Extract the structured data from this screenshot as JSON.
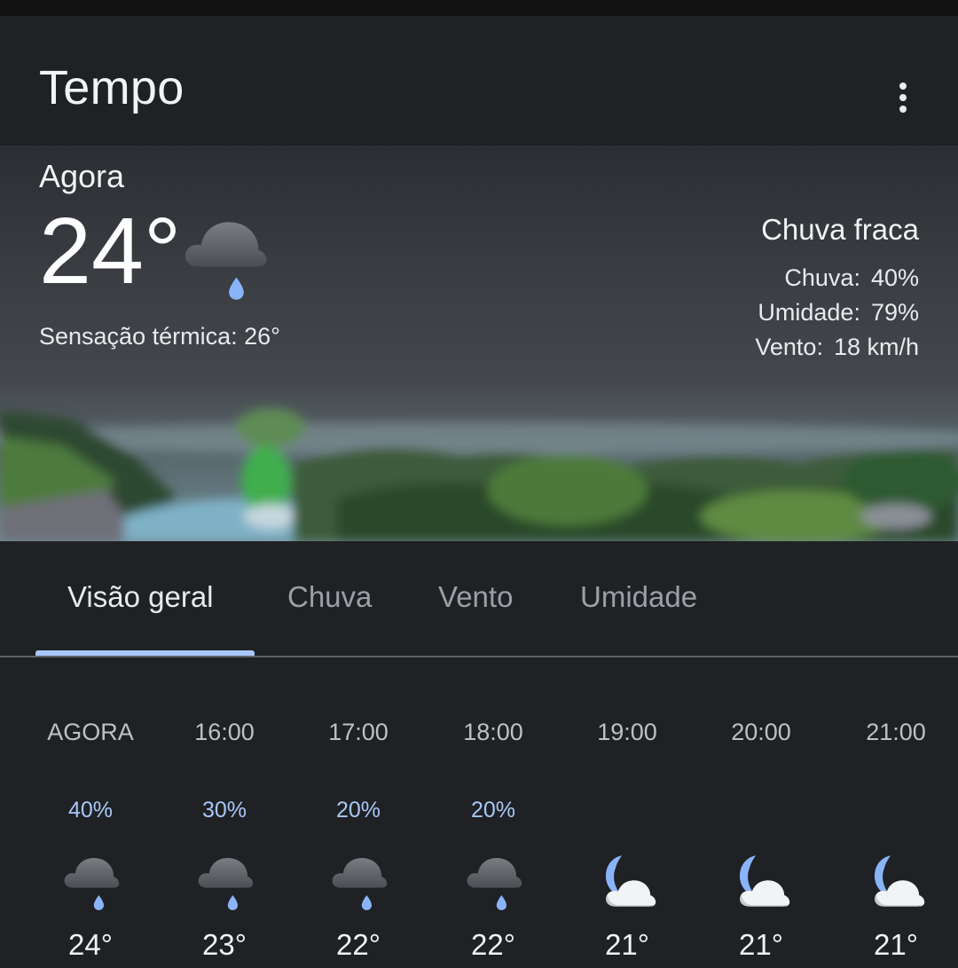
{
  "app": {
    "title": "Tempo"
  },
  "current": {
    "label": "Agora",
    "temperature": "24°",
    "feels_like": "Sensação térmica: 26°",
    "condition": "Chuva fraca",
    "condition_icon": "cloud-rain-icon",
    "details": [
      {
        "label": "Chuva:",
        "value": "40%"
      },
      {
        "label": "Umidade:",
        "value": "79%"
      },
      {
        "label": "Vento:",
        "value": "18 km/h"
      }
    ]
  },
  "tabs": [
    {
      "label": "Visão geral",
      "active": true
    },
    {
      "label": "Chuva",
      "active": false
    },
    {
      "label": "Vento",
      "active": false
    },
    {
      "label": "Umidade",
      "active": false
    }
  ],
  "hourly": [
    {
      "time": "AGORA",
      "precip": "40%",
      "icon": "cloud-rain-icon",
      "temp": "24°"
    },
    {
      "time": "16:00",
      "precip": "30%",
      "icon": "cloud-rain-icon",
      "temp": "23°"
    },
    {
      "time": "17:00",
      "precip": "20%",
      "icon": "cloud-rain-icon",
      "temp": "22°"
    },
    {
      "time": "18:00",
      "precip": "20%",
      "icon": "cloud-rain-icon",
      "temp": "22°"
    },
    {
      "time": "19:00",
      "precip": "",
      "icon": "moon-cloud-icon",
      "temp": "21°"
    },
    {
      "time": "20:00",
      "precip": "",
      "icon": "moon-cloud-icon",
      "temp": "21°"
    },
    {
      "time": "21:00",
      "precip": "",
      "icon": "moon-cloud-icon",
      "temp": "21°"
    }
  ],
  "colors": {
    "background": "#202124",
    "accent": "#a8c7fa",
    "rain_drop": "#8ab4f8",
    "moon": "#8ab4f8"
  }
}
